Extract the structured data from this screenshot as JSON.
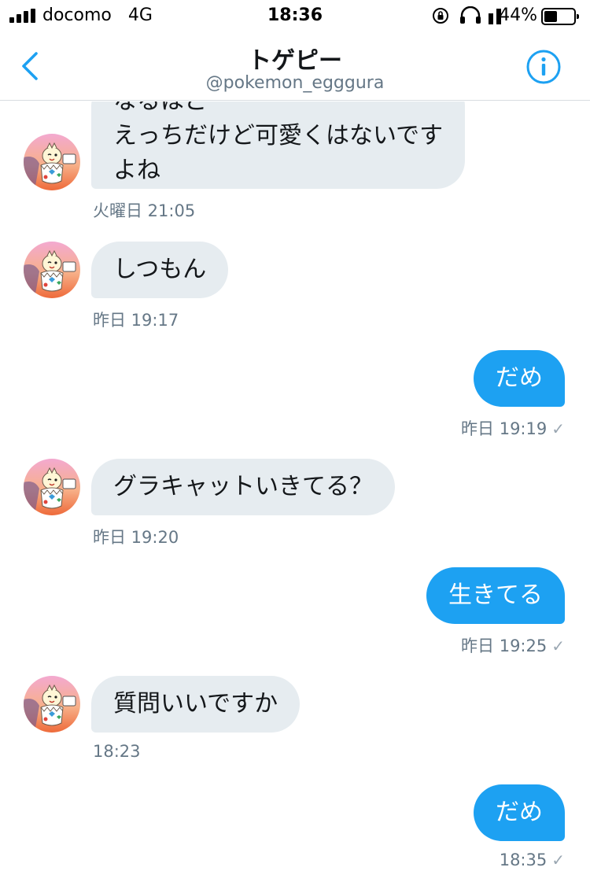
{
  "status_bar": {
    "carrier": "docomo",
    "network": "4G",
    "time": "18:36",
    "battery_percent": "44%",
    "battery_level": 0.44,
    "icons": [
      "signal-icon",
      "orientation-lock-icon",
      "headphones-icon",
      "battery-icon"
    ]
  },
  "header": {
    "title": "トゲピー",
    "handle": "@pokemon_egggura",
    "back_icon": "chevron-left-icon",
    "info_icon": "info-icon",
    "accent_color": "#1da1f2"
  },
  "messages": [
    {
      "direction": "in",
      "lines": [
        "なるほど",
        "えっちだけど可愛くはないです",
        "よね"
      ],
      "timestamp": "火曜日 21:05"
    },
    {
      "direction": "in",
      "text": "しつもん",
      "timestamp": "昨日 19:17"
    },
    {
      "direction": "out",
      "text": "だめ",
      "timestamp": "昨日 19:19"
    },
    {
      "direction": "in",
      "text": "グラキャットいきてる？",
      "timestamp": "昨日 19:20"
    },
    {
      "direction": "out",
      "text": "生きてる",
      "timestamp": "昨日 19:25"
    },
    {
      "direction": "in",
      "text": "質問いいですか",
      "timestamp": "18:23"
    },
    {
      "direction": "out",
      "text": "だめ",
      "timestamp": "18:35"
    }
  ],
  "colors": {
    "incoming_bubble": "#e6ecf0",
    "outgoing_bubble": "#1da1f2",
    "timestamp": "#657786"
  }
}
